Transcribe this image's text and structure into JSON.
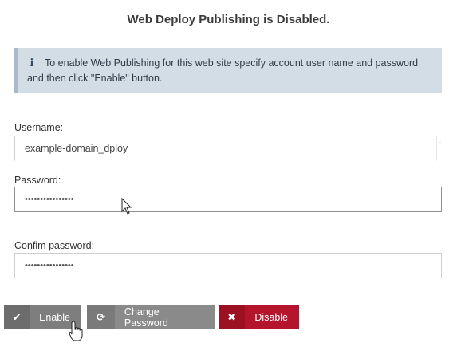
{
  "title": "Web Deploy Publishing is Disabled.",
  "info": {
    "icon": "info-icon",
    "glyph": "i",
    "text": "To enable Web Publishing for this web site specify account user name and password and then click \"Enable\" button."
  },
  "form": {
    "username_label": "Username:",
    "username_value": "example-domain_dploy",
    "password_label": "Password:",
    "password_value": "••••••••••••••••",
    "confirm_label": "Confim password:",
    "confirm_value": "••••••••••••••••"
  },
  "buttons": {
    "enable": {
      "icon": "check-icon",
      "glyph": "✔",
      "label": "Enable"
    },
    "change_password": {
      "icon": "refresh-icon",
      "glyph": "⟳",
      "label": "Change Password"
    },
    "disable": {
      "icon": "close-icon",
      "glyph": "✖",
      "label": "Disable"
    }
  },
  "colors": {
    "info_background": "#d3dde6",
    "button_gray": "#7e7e7e",
    "button_danger": "#b5142d"
  }
}
